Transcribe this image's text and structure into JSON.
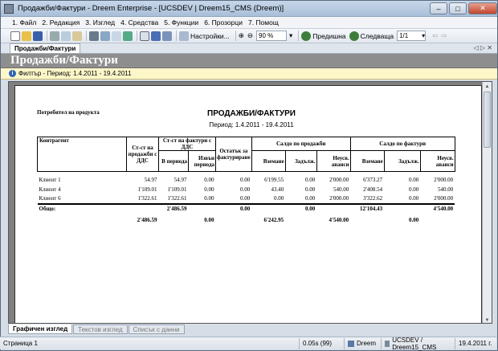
{
  "window": {
    "title": "Продажби/Фактури - Dreem Enterprise - [UCSDEV | Dreem15_CMS (Dreem)]",
    "minimize": "–",
    "maximize": "□",
    "close": "✕"
  },
  "menu": [
    "1. Файл",
    "2. Редакция",
    "3. Изглед",
    "4. Средства",
    "5. Функции",
    "6. Прозорци",
    "7. Помощ"
  ],
  "toolbar": {
    "settings_label": "Настройки...",
    "zoom_value": "90 %",
    "prev_label": "Предишна",
    "next_label": "Следваща",
    "page_value": "1/1"
  },
  "doc_tab": "Продажби/Фактури",
  "header_title": "Продажби/Фактури",
  "filter_text": "Филтър - Период: 1.4.2011 - 19.4.2011",
  "report": {
    "consumer_label": "Потребител на продукта",
    "title": "ПРОДАЖБИ/ФАКТУРИ",
    "period": "Период: 1.4.2011 - 19.4.2011",
    "headers": {
      "contragent": "Контрагент",
      "sales_vat": "Ст-ст на продажби с ДДС",
      "invoices_vat": "Ст-ст на фактури с ДДС",
      "in_period": "В периода",
      "out_period": "Извън периода",
      "to_invoice": "Остатък за фактуриране",
      "balance_sales": "Салдо по продажби",
      "balance_invoices": "Салдо по фактури",
      "receivable": "Вземане",
      "liability": "Задълж.",
      "unused_adv": "Неусв. аванси"
    },
    "rows": [
      [
        "Клиент 1",
        "54.97",
        "54.97",
        "0.00",
        "0.00",
        "6'199.55",
        "0.00",
        "2'000.00",
        "6'373.27",
        "0.00",
        "2'000.00"
      ],
      [
        "Клиент 4",
        "1'109.01",
        "1'109.01",
        "0.00",
        "0.00",
        "43.40",
        "0.00",
        "540.00",
        "2'408.54",
        "0.00",
        "540.00"
      ],
      [
        "Клиент 6",
        "1'322.61",
        "1'322.61",
        "0.00",
        "0.00",
        "0.00",
        "0.00",
        "2'000.00",
        "3'322.62",
        "0.00",
        "2'000.00"
      ]
    ],
    "total_label": "Общо:",
    "total_row": [
      "",
      "2'486.59",
      "",
      "0.00",
      "",
      "0.00",
      "",
      "12'104.43",
      "",
      "4'540.00"
    ],
    "grand_row": [
      "2'486.59",
      "0.00",
      "",
      "6'242.95",
      "4'540.00",
      "0.00"
    ]
  },
  "bottom_tabs": [
    "Графичен изглед",
    "Текстов изглед",
    "Списък с данни"
  ],
  "status": {
    "page": "Страница 1",
    "time": "0.05s (99)",
    "app": "Dreem",
    "connection": "UCSDEV / Dreem15_CMS",
    "date": "19.4.2011 г."
  }
}
